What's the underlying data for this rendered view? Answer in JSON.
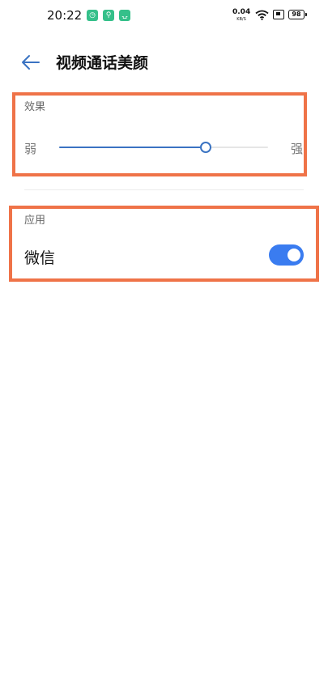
{
  "status_bar": {
    "time": "20:22",
    "notifications": [
      "app-icon",
      "location-icon",
      "cart-icon"
    ],
    "net_speed_value": "0.04",
    "net_speed_unit": "KB/S",
    "battery": "98"
  },
  "header": {
    "title": "视频通话美颜"
  },
  "effect_section": {
    "label": "效果",
    "min_label": "弱",
    "max_label": "强",
    "slider_value": 0.7
  },
  "apply_section": {
    "label": "应用",
    "items": [
      {
        "label": "微信",
        "enabled": true
      }
    ]
  },
  "colors": {
    "accent": "#3a7cf0",
    "highlight_box": "#ef7348"
  }
}
